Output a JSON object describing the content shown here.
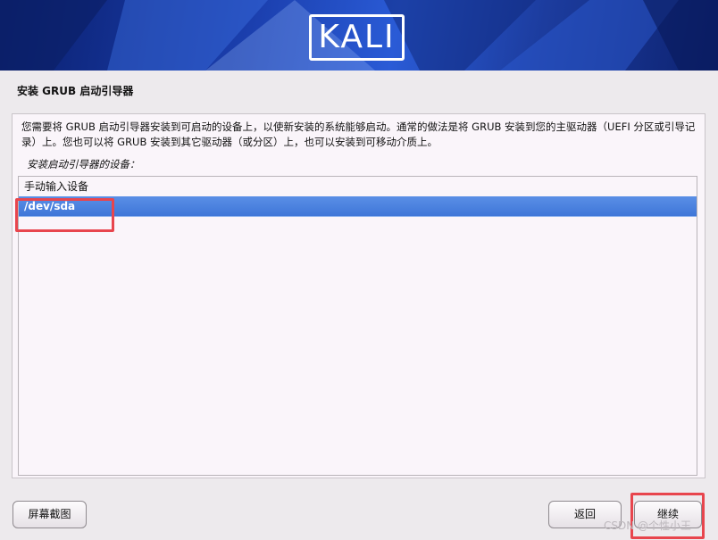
{
  "banner": {
    "logo_text": "KALI"
  },
  "page": {
    "title": "安装 GRUB 启动引导器"
  },
  "content": {
    "description": "您需要将 GRUB 启动引导器安装到可启动的设备上，以使新安装的系统能够启动。通常的做法是将 GRUB 安装到您的主驱动器（UEFI 分区或引导记录）上。您也可以将 GRUB 安装到其它驱动器（或分区）上，也可以安装到可移动介质上。",
    "list_label": "安装启动引导器的设备：",
    "devices": [
      {
        "label": "手动输入设备",
        "selected": false
      },
      {
        "label": "/dev/sda",
        "selected": true
      }
    ]
  },
  "buttons": {
    "screenshot": "屏幕截图",
    "back": "返回",
    "continue": "继续"
  },
  "annotation_color": "#e8454d",
  "watermark": "CSDN @个性小王"
}
